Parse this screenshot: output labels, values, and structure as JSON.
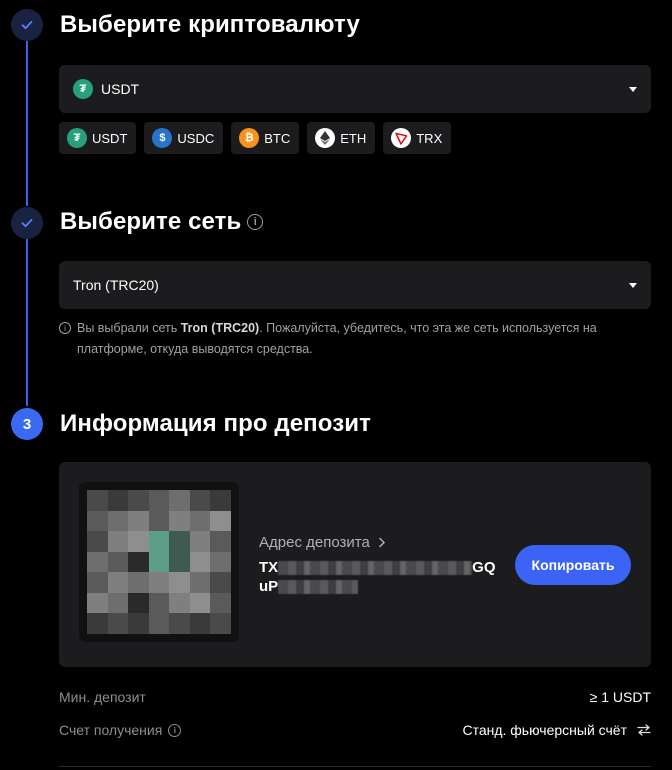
{
  "steps": {
    "step1_title": "Выберите криптовалюту",
    "step2_title": "Выберите сеть",
    "step3_title": "Информация про депозит",
    "step3_number": "3"
  },
  "currency_select": {
    "value": "USDT",
    "icon": "usdt-coin-icon"
  },
  "quick_coins": [
    {
      "label": "USDT",
      "icon": "usdt-coin-icon",
      "glyph": "₮"
    },
    {
      "label": "USDC",
      "icon": "usdc-coin-icon",
      "glyph": "$"
    },
    {
      "label": "BTC",
      "icon": "btc-coin-icon",
      "glyph": "₿"
    },
    {
      "label": "ETH",
      "icon": "eth-coin-icon",
      "glyph": "◆"
    },
    {
      "label": "TRX",
      "icon": "trx-coin-icon",
      "glyph": "▼"
    }
  ],
  "network_select": {
    "value": "Tron (TRC20)"
  },
  "network_note": {
    "prefix": "Вы выбрали сеть ",
    "network": "Tron (TRC20)",
    "suffix": ". Пожалуйста, убедитесь, что эта же сеть используется на платформе, откуда выводятся средства."
  },
  "deposit": {
    "address_label": "Адрес депозита",
    "address_start": "TX",
    "address_end_line1": "GQ",
    "address_start_line2": "uP",
    "copy_label": "Копировать"
  },
  "details": {
    "min_deposit_label": "Мин. депозит",
    "min_deposit_value": "≥ 1 USDT",
    "account_label": "Счет получения",
    "account_value": "Станд. фьючерсный счёт"
  },
  "colors": {
    "accent": "#3b63f5",
    "background": "#000000",
    "panel": "#1c1c1e",
    "usdt": "#26a17b",
    "usdc": "#2775ca",
    "btc": "#f7931a",
    "trx": "#e50915"
  }
}
